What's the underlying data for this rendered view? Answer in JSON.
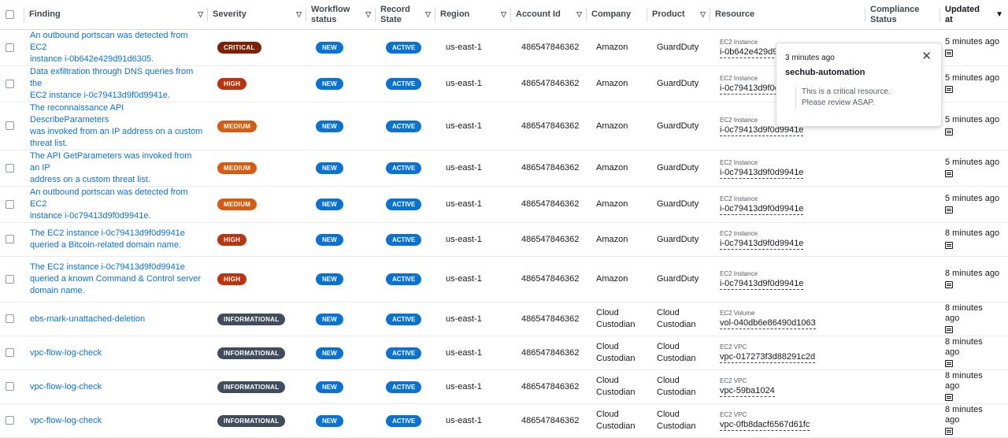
{
  "columns": {
    "finding": "Finding",
    "severity": "Severity",
    "workflow_1": "Workflow",
    "workflow_2": "status",
    "record_1": "Record",
    "record_2": "State",
    "region": "Region",
    "account": "Account Id",
    "company": "Company",
    "product": "Product",
    "resource": "Resource",
    "compliance_1": "Compliance",
    "compliance_2": "Status",
    "updated": "Updated at"
  },
  "severity_colors": {
    "CRITICAL": "#7d2105",
    "HIGH": "#b9350f",
    "MEDIUM": "#d45d11",
    "INFORMATIONAL": "#414d5c"
  },
  "accent_color": "#0972d3",
  "rows": [
    {
      "finding_1": "An outbound portscan was detected from EC2",
      "finding_2": "instance i-0b642e429d91d6305.",
      "finding_3": "",
      "severity": "CRITICAL",
      "workflow": "NEW",
      "record": "ACTIVE",
      "region": "us-east-1",
      "account": "486547846362",
      "company_1": "Amazon",
      "company_2": "",
      "product_1": "GuardDuty",
      "product_2": "",
      "resource_type": "EC2 Instance",
      "resource_id": "i-0b642e429d91d6305",
      "updated_1": "5 minutes ago",
      "updated_2": ""
    },
    {
      "finding_1": "Data exfiltration through DNS queries from the",
      "finding_2": "EC2 instance i-0c79413d9f0d9941e.",
      "finding_3": "",
      "severity": "HIGH",
      "workflow": "NEW",
      "record": "ACTIVE",
      "region": "us-east-1",
      "account": "486547846362",
      "company_1": "Amazon",
      "company_2": "",
      "product_1": "GuardDuty",
      "product_2": "",
      "resource_type": "EC2 Instance",
      "resource_id": "i-0c79413d9f0d9941e",
      "updated_1": "5 minutes ago",
      "updated_2": ""
    },
    {
      "finding_1": "The reconnaissance API DescribeParameters",
      "finding_2": "was invoked from an IP address on a custom",
      "finding_3": "threat list.",
      "severity": "MEDIUM",
      "workflow": "NEW",
      "record": "ACTIVE",
      "region": "us-east-1",
      "account": "486547846362",
      "company_1": "Amazon",
      "company_2": "",
      "product_1": "GuardDuty",
      "product_2": "",
      "resource_type": "EC2 Instance",
      "resource_id": "i-0c79413d9f0d9941e",
      "updated_1": "5 minutes ago",
      "updated_2": ""
    },
    {
      "finding_1": "The API GetParameters was invoked from an IP",
      "finding_2": "address on a custom threat list.",
      "finding_3": "",
      "severity": "MEDIUM",
      "workflow": "NEW",
      "record": "ACTIVE",
      "region": "us-east-1",
      "account": "486547846362",
      "company_1": "Amazon",
      "company_2": "",
      "product_1": "GuardDuty",
      "product_2": "",
      "resource_type": "EC2 Instance",
      "resource_id": "i-0c79413d9f0d9941e",
      "updated_1": "5 minutes ago",
      "updated_2": ""
    },
    {
      "finding_1": "An outbound portscan was detected from EC2",
      "finding_2": "instance i-0c79413d9f0d9941e.",
      "finding_3": "",
      "severity": "MEDIUM",
      "workflow": "NEW",
      "record": "ACTIVE",
      "region": "us-east-1",
      "account": "486547846362",
      "company_1": "Amazon",
      "company_2": "",
      "product_1": "GuardDuty",
      "product_2": "",
      "resource_type": "EC2 Instance",
      "resource_id": "i-0c79413d9f0d9941e",
      "updated_1": "5 minutes ago",
      "updated_2": ""
    },
    {
      "finding_1": "The EC2 instance i-0c79413d9f0d9941e",
      "finding_2": "queried a Bitcoin-related domain name.",
      "finding_3": "",
      "severity": "HIGH",
      "workflow": "NEW",
      "record": "ACTIVE",
      "region": "us-east-1",
      "account": "486547846362",
      "company_1": "Amazon",
      "company_2": "",
      "product_1": "GuardDuty",
      "product_2": "",
      "resource_type": "EC2 Instance",
      "resource_id": "i-0c79413d9f0d9941e",
      "updated_1": "8 minutes ago",
      "updated_2": ""
    },
    {
      "finding_1": "The EC2 instance i-0c79413d9f0d9941e",
      "finding_2": "queried a known Command & Control server",
      "finding_3": "domain name.",
      "severity": "HIGH",
      "workflow": "NEW",
      "record": "ACTIVE",
      "region": "us-east-1",
      "account": "486547846362",
      "company_1": "Amazon",
      "company_2": "",
      "product_1": "GuardDuty",
      "product_2": "",
      "resource_type": "EC2 Instance",
      "resource_id": "i-0c79413d9f0d9941e",
      "updated_1": "8 minutes ago",
      "updated_2": ""
    },
    {
      "finding_1": "ebs-mark-unattached-deletion",
      "finding_2": "",
      "finding_3": "",
      "severity": "INFORMATIONAL",
      "workflow": "NEW",
      "record": "ACTIVE",
      "region": "us-east-1",
      "account": "486547846362",
      "company_1": "Cloud",
      "company_2": "Custodian",
      "product_1": "Cloud",
      "product_2": "Custodian",
      "resource_type": "EC2 Volume",
      "resource_id": "vol-040db6e86490d1063",
      "updated_1": "8 minutes",
      "updated_2": "ago"
    },
    {
      "finding_1": "vpc-flow-log-check",
      "finding_2": "",
      "finding_3": "",
      "severity": "INFORMATIONAL",
      "workflow": "NEW",
      "record": "ACTIVE",
      "region": "us-east-1",
      "account": "486547846362",
      "company_1": "Cloud",
      "company_2": "Custodian",
      "product_1": "Cloud",
      "product_2": "Custodian",
      "resource_type": "EC2 VPC",
      "resource_id": "vpc-017273f3d88291c2d",
      "updated_1": "8 minutes",
      "updated_2": "ago"
    },
    {
      "finding_1": "vpc-flow-log-check",
      "finding_2": "",
      "finding_3": "",
      "severity": "INFORMATIONAL",
      "workflow": "NEW",
      "record": "ACTIVE",
      "region": "us-east-1",
      "account": "486547846362",
      "company_1": "Cloud",
      "company_2": "Custodian",
      "product_1": "Cloud",
      "product_2": "Custodian",
      "resource_type": "EC2 VPC",
      "resource_id": "vpc-59ba1024",
      "updated_1": "8 minutes",
      "updated_2": "ago"
    },
    {
      "finding_1": "vpc-flow-log-check",
      "finding_2": "",
      "finding_3": "",
      "severity": "INFORMATIONAL",
      "workflow": "NEW",
      "record": "ACTIVE",
      "region": "us-east-1",
      "account": "486547846362",
      "company_1": "Cloud",
      "company_2": "Custodian",
      "product_1": "Cloud",
      "product_2": "Custodian",
      "resource_type": "EC2 VPC",
      "resource_id": "vpc-0fb8dacf6567d61fc",
      "updated_1": "8 minutes",
      "updated_2": "ago"
    }
  ],
  "popover": {
    "time": "3 minutes ago",
    "title": "sechub-automation",
    "body_1": "This is a critical resource.",
    "body_2": "Please review ASAP.",
    "close_icon": "close-icon"
  }
}
